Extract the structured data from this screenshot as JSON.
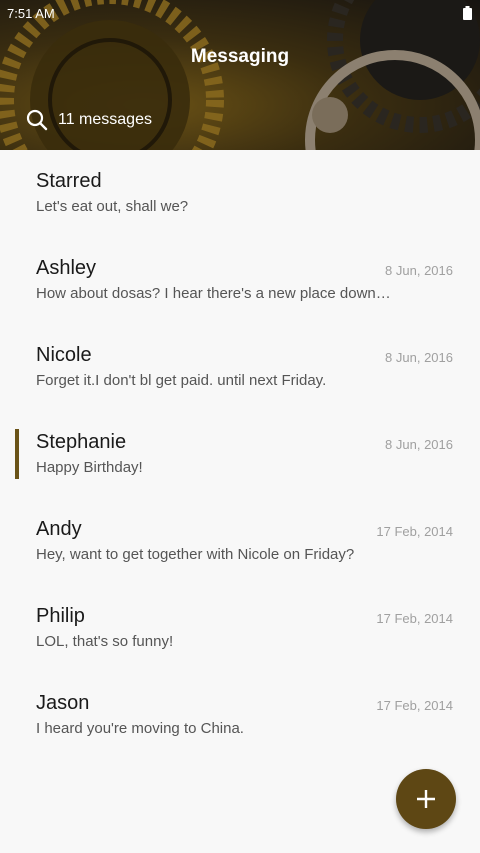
{
  "status_bar": {
    "time": "7:51 AM"
  },
  "header": {
    "title": "Messaging",
    "search_label": "11 messages"
  },
  "conversations": [
    {
      "name": "Starred",
      "date": "",
      "preview": "Let's eat out, shall we?"
    },
    {
      "name": "Ashley",
      "date": "8 Jun, 2016",
      "preview": "How about dosas? I hear there's a new place down the street."
    },
    {
      "name": "Nicole",
      "date": "8 Jun, 2016",
      "preview": "Forget it.I don't bl get paid. until next Friday."
    },
    {
      "name": "Stephanie",
      "date": "8 Jun, 2016",
      "preview": "Happy Birthday!",
      "selected": true
    },
    {
      "name": "Andy",
      "date": "17 Feb, 2014",
      "preview": "Hey, want to get together with Nicole on Friday?"
    },
    {
      "name": "Philip",
      "date": "17 Feb, 2014",
      "preview": "LOL, that's so funny!"
    },
    {
      "name": "Jason",
      "date": "17 Feb, 2014",
      "preview": "I heard you're moving to China."
    }
  ],
  "fab": {
    "icon": "plus-icon"
  },
  "colors": {
    "accent": "#5e4714",
    "header_dark": "#161310"
  }
}
